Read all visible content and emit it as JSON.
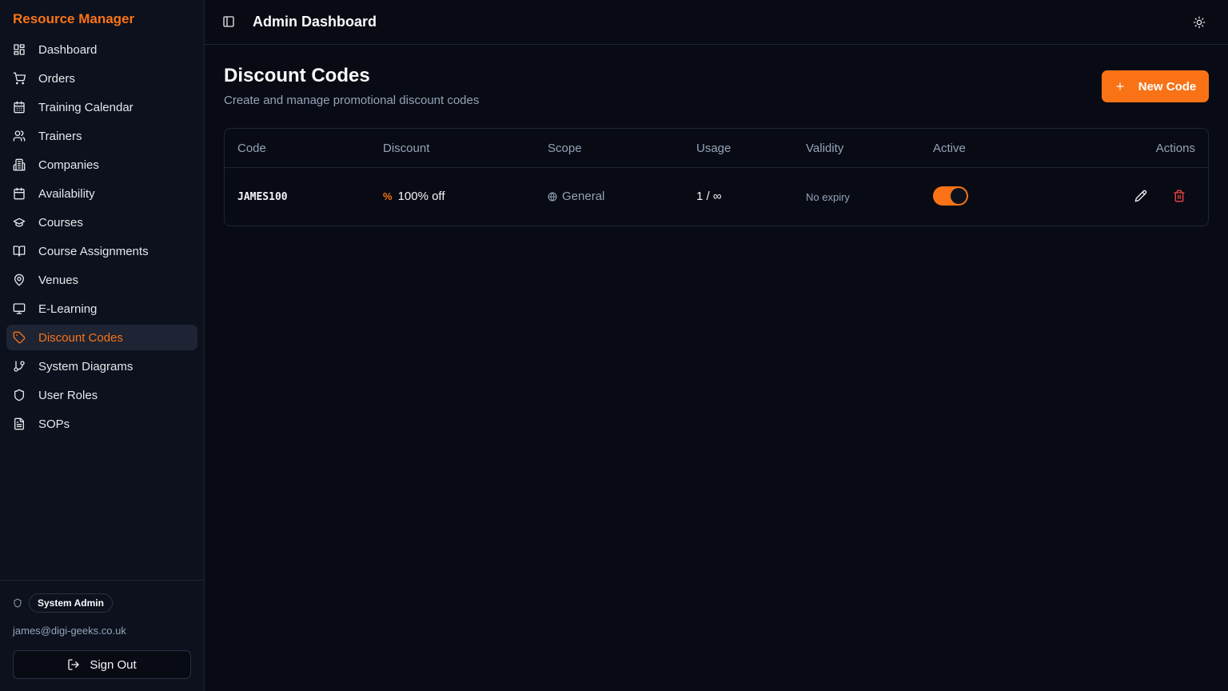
{
  "app": {
    "brand": "Resource Manager"
  },
  "sidebar": {
    "items": [
      {
        "label": "Dashboard",
        "icon": "grid-icon"
      },
      {
        "label": "Orders",
        "icon": "cart-icon"
      },
      {
        "label": "Training Calendar",
        "icon": "calendar-days-icon"
      },
      {
        "label": "Trainers",
        "icon": "users-icon"
      },
      {
        "label": "Companies",
        "icon": "building-icon"
      },
      {
        "label": "Availability",
        "icon": "calendar-icon"
      },
      {
        "label": "Courses",
        "icon": "graduation-cap-icon"
      },
      {
        "label": "Course Assignments",
        "icon": "book-open-icon"
      },
      {
        "label": "Venues",
        "icon": "map-pin-icon"
      },
      {
        "label": "E-Learning",
        "icon": "monitor-icon"
      },
      {
        "label": "Discount Codes",
        "icon": "tag-icon",
        "active": true
      },
      {
        "label": "System Diagrams",
        "icon": "git-branch-icon"
      },
      {
        "label": "User Roles",
        "icon": "shield-icon"
      },
      {
        "label": "SOPs",
        "icon": "file-text-icon"
      }
    ],
    "footer": {
      "role": "System Admin",
      "email": "james@digi-geeks.co.uk",
      "sign_out": "Sign Out"
    }
  },
  "header": {
    "title": "Admin Dashboard"
  },
  "main": {
    "title": "Discount Codes",
    "subtitle": "Create and manage promotional discount codes",
    "new_button": "New Code",
    "table": {
      "columns": [
        "Code",
        "Discount",
        "Scope",
        "Usage",
        "Validity",
        "Active",
        "Actions"
      ],
      "rows": [
        {
          "code": "JAMES100",
          "discount_symbol": "%",
          "discount": "100% off",
          "scope": "General",
          "usage": "1 / ∞",
          "validity": "No expiry",
          "active": true
        }
      ]
    }
  },
  "colors": {
    "accent": "#f97316",
    "background": "#090b14",
    "sidebar": "#0c111d",
    "danger": "#ef4444"
  }
}
